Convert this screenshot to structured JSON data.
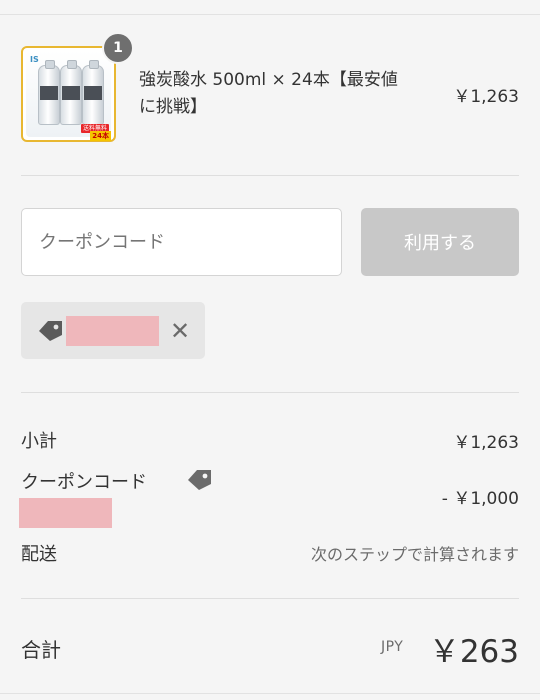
{
  "product": {
    "quantity": "1",
    "name": "強炭酸水 500ml × 24本【最安値に挑戦】",
    "price": "￥1,263",
    "image": {
      "logo": "IS",
      "tag": "送料無料",
      "count": "24本"
    }
  },
  "coupon": {
    "placeholder": "クーポンコード",
    "value": "",
    "apply_label": "利用する",
    "applied_tag_icon": "tag-icon",
    "remove_icon": "✕"
  },
  "summary": {
    "subtotal_label": "小計",
    "subtotal_value": "￥1,263",
    "coupon_label": "クーポンコード",
    "coupon_value": "- ￥1,000",
    "shipping_label": "配送",
    "shipping_value": "次のステップで計算されます"
  },
  "total": {
    "label": "合計",
    "currency": "JPY",
    "amount": "￥263"
  },
  "colors": {
    "background": "#f5f5f5",
    "apply_button": "#c8c8c8",
    "redaction": "#efb7bb",
    "thumb_border": "#e8b731",
    "badge": "#6f6f6f"
  }
}
